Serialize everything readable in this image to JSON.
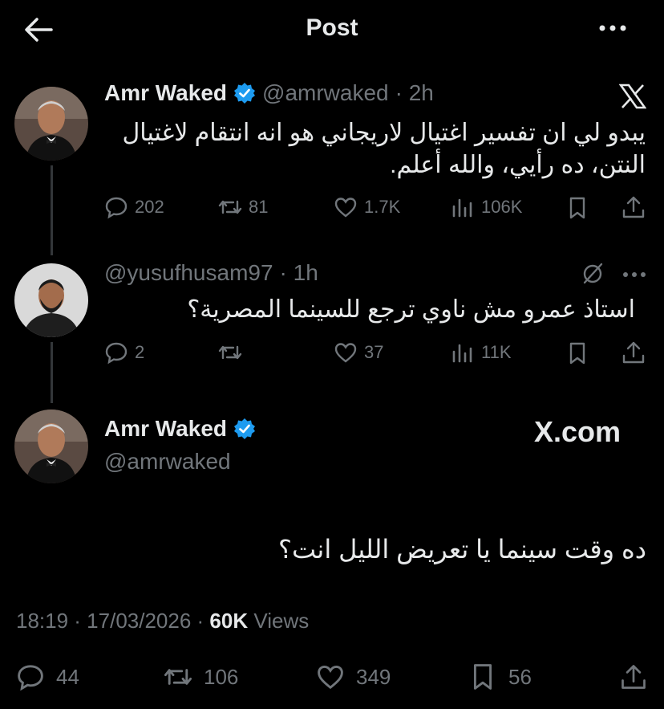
{
  "header": {
    "title": "Post"
  },
  "tweet1": {
    "name": "Amr Waked",
    "handle": "@amrwaked",
    "time": "· 2h",
    "text_line1": "يبدو لي ان تفسير اغتيال لاريجاني هو انه انتقام لاغتيال",
    "text_line2": "النتن، ده رأيي، والله أعلم.",
    "replies": "202",
    "reposts": "81",
    "likes": "1.7K",
    "views": "106K"
  },
  "tweet2": {
    "handle": "@yusufhusam97",
    "time": "· 1h",
    "text": "استاذ عمرو مش ناوي ترجع للسينما المصرية؟",
    "replies": "2",
    "reposts": "",
    "likes": "37",
    "views": "11K"
  },
  "main_post": {
    "name": "Amr Waked",
    "handle": "@amrwaked",
    "watermark": "X.com",
    "text": "ده وقت سينما يا تعريض الليل انت؟",
    "timestamp": "18:19 · 17/03/2026 ·",
    "views_count": "60K",
    "views_label": "Views",
    "replies": "44",
    "reposts": "106",
    "likes": "349",
    "bookmarks": "56"
  },
  "colors": {
    "background": "#000000",
    "text": "#e7e9ea",
    "muted": "#71767b",
    "verified": "#1d9bf0"
  }
}
